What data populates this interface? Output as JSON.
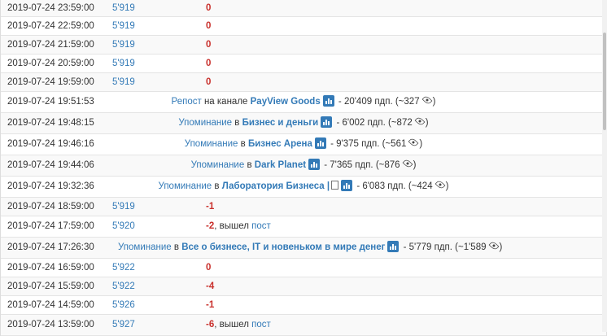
{
  "rows": [
    {
      "kind": "stat",
      "date": "2019-07-24 23:59:00",
      "subs": "5'919",
      "delta": "0"
    },
    {
      "kind": "stat",
      "date": "2019-07-24 22:59:00",
      "subs": "5'919",
      "delta": "0"
    },
    {
      "kind": "stat",
      "date": "2019-07-24 21:59:00",
      "subs": "5'919",
      "delta": "0"
    },
    {
      "kind": "stat",
      "date": "2019-07-24 20:59:00",
      "subs": "5'919",
      "delta": "0"
    },
    {
      "kind": "stat",
      "date": "2019-07-24 19:59:00",
      "subs": "5'919",
      "delta": "0"
    },
    {
      "kind": "mention",
      "date": "2019-07-24 19:51:53",
      "type": "Репост",
      "prep": "на канале",
      "channel": "PayView Goods",
      "after": "- 20'409 пдп. (~327"
    },
    {
      "kind": "mention",
      "date": "2019-07-24 19:48:15",
      "type": "Упоминание",
      "prep": "в",
      "channel": "Бизнес и деньги",
      "after": "- 6'002 пдп. (~872"
    },
    {
      "kind": "mention",
      "date": "2019-07-24 19:46:16",
      "type": "Упоминание",
      "prep": "в",
      "channel": "Бизнес Арена",
      "after": "- 9'375 пдп. (~561"
    },
    {
      "kind": "mention",
      "date": "2019-07-24 19:44:06",
      "type": "Упоминание",
      "prep": "в",
      "channel": "Dark Planet",
      "after": "- 7'365 пдп. (~876"
    },
    {
      "kind": "mention",
      "date": "2019-07-24 19:32:36",
      "type": "Упоминание",
      "prep": "в",
      "channel": "Лаборатория Бизнеса |",
      "box": true,
      "after": "- 6'083 пдп. (~424"
    },
    {
      "kind": "stat",
      "date": "2019-07-24 18:59:00",
      "subs": "5'919",
      "delta": "-1"
    },
    {
      "kind": "stat",
      "date": "2019-07-24 17:59:00",
      "subs": "5'920",
      "delta": "-2",
      "tail": ", вышел ",
      "tail_link": "пост"
    },
    {
      "kind": "mention",
      "date": "2019-07-24 17:26:30",
      "type": "Упоминание",
      "prep": "в",
      "channel": "Все о бизнесе, IT и новеньком в мире денег",
      "after": "- 5'779 пдп. (~1'589"
    },
    {
      "kind": "stat",
      "date": "2019-07-24 16:59:00",
      "subs": "5'922",
      "delta": "0"
    },
    {
      "kind": "stat",
      "date": "2019-07-24 15:59:00",
      "subs": "5'922",
      "delta": "-4"
    },
    {
      "kind": "stat",
      "date": "2019-07-24 14:59:00",
      "subs": "5'926",
      "delta": "-1"
    },
    {
      "kind": "stat",
      "date": "2019-07-24 13:59:00",
      "subs": "5'927",
      "delta": "-6",
      "tail": ", вышел ",
      "tail_link": "пост"
    }
  ],
  "colors": {
    "link": "#337ab7",
    "negative": "#c9302c"
  },
  "icons": {
    "stats": "bar-chart-icon",
    "views": "eye-icon"
  }
}
